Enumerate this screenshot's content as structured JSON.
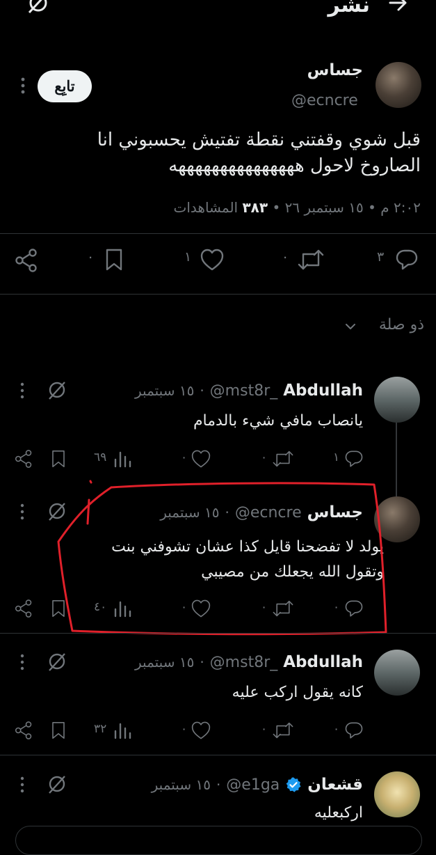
{
  "header": {
    "title": "نشر"
  },
  "tweet": {
    "author_name": "جساس",
    "author_handle": "@ecncre",
    "follow_label": "تابِع",
    "text_line1": "قبل شوي وقفتني نقطة تفتيش يحسبوني انا",
    "text_line2": "الصاروخ لاحول هههههههههههههههه",
    "time": "٢:٠٢ م",
    "date": "١٥ سبتمبر ٢٦",
    "views_count": "٣٨٣",
    "views_label": "المشاهدات",
    "stats": {
      "replies": "٣",
      "retweets": "٠",
      "likes": "١",
      "bookmarks": "٠"
    }
  },
  "filter": {
    "label": "ذو صلة"
  },
  "replies": [
    {
      "name": "Abdullah",
      "handle": "@mst8r_",
      "date": "١٥ سبتمبر",
      "text": "يانصاب مافي شيء بالدمام",
      "stats": {
        "replies": "١",
        "retweets": "٠",
        "likes": "٠",
        "views": "٦٩"
      }
    },
    {
      "name": "جساس",
      "handle": "@ecncre",
      "date": "١٥ سبتمبر",
      "text_line1": "يولد لا تفضحنا قايل كذا عشان تشوفني بنت",
      "text_line2": "وتقول الله يجعلك من مصيبي",
      "stats": {
        "replies": "٠",
        "retweets": "٠",
        "likes": "٠",
        "views": "٤٠"
      }
    },
    {
      "name": "Abdullah",
      "handle": "@mst8r_",
      "date": "١٥ سبتمبر",
      "text": "كانه يقول اركب عليه",
      "stats": {
        "replies": "٠",
        "retweets": "٠",
        "likes": "٠",
        "views": "٣٢"
      }
    },
    {
      "name": "قشعان",
      "handle": "@e1ga",
      "date": "١٥ سبتمبر",
      "text": "اركبعليه"
    }
  ],
  "colors": {
    "background": "#000000",
    "text": "#e7e9ea",
    "muted": "#71767b",
    "verified": "#1d9bf0",
    "annotation": "#e0202a"
  }
}
